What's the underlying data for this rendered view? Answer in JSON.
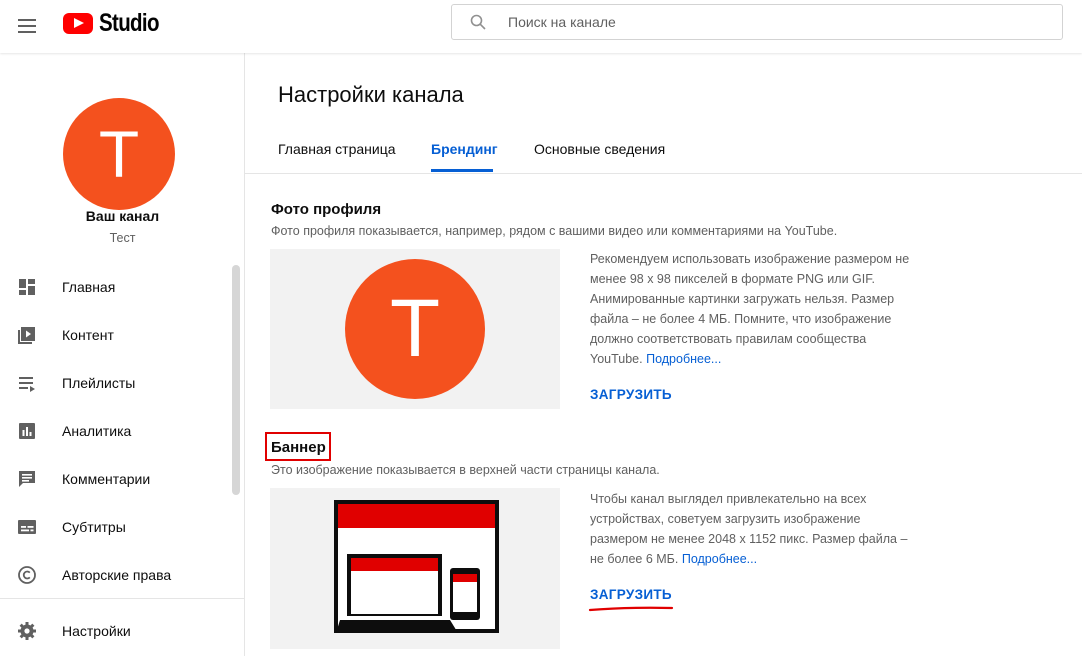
{
  "app": {
    "logo_text": "Studio",
    "search": {
      "placeholder": "Поиск на канале"
    }
  },
  "sidebar": {
    "avatar_letter": "T",
    "channel_name": "Ваш канал",
    "channel_handle": "Тест",
    "items": [
      {
        "label": "Главная",
        "icon": "dashboard-icon"
      },
      {
        "label": "Контент",
        "icon": "content-icon"
      },
      {
        "label": "Плейлисты",
        "icon": "playlists-icon"
      },
      {
        "label": "Аналитика",
        "icon": "analytics-icon"
      },
      {
        "label": "Комментарии",
        "icon": "comments-icon"
      },
      {
        "label": "Субтитры",
        "icon": "subtitles-icon"
      },
      {
        "label": "Авторские права",
        "icon": "copyright-icon"
      },
      {
        "label": "Настройки",
        "icon": "settings-icon"
      }
    ]
  },
  "main": {
    "title": "Настройки канала",
    "tabs": [
      {
        "label": "Главная страница",
        "active": false
      },
      {
        "label": "Брендинг",
        "active": true
      },
      {
        "label": "Основные сведения",
        "active": false
      }
    ],
    "profile": {
      "title": "Фото профиля",
      "description": "Фото профиля показывается, например, рядом с вашими видео или комментариями на YouTube.",
      "avatar_letter": "T",
      "info": "Рекомендуем использовать изображение размером не менее 98 x 98 пикселей в формате PNG или GIF. Анимированные картинки загружать нельзя. Размер файла – не более 4 МБ. Помните, что изображение должно соответствовать правилам сообщества YouTube.",
      "more_link": "Подробнее...",
      "upload": "ЗАГРУЗИТЬ"
    },
    "banner": {
      "title": "Баннер",
      "description": "Это изображение показывается в верхней части страницы канала.",
      "info": "Чтобы канал выглядел привлекательно на всех устройствах, советуем загрузить изображение размером не менее 2048 x 1152 пикс. Размер файла – не более 6 МБ.",
      "more_link": "Подробнее...",
      "upload": "ЗАГРУЗИТЬ"
    }
  },
  "colors": {
    "accent": "#065fd4",
    "avatar": "#f4511e",
    "highlight": "#e00000",
    "logo": "#ff0000"
  }
}
